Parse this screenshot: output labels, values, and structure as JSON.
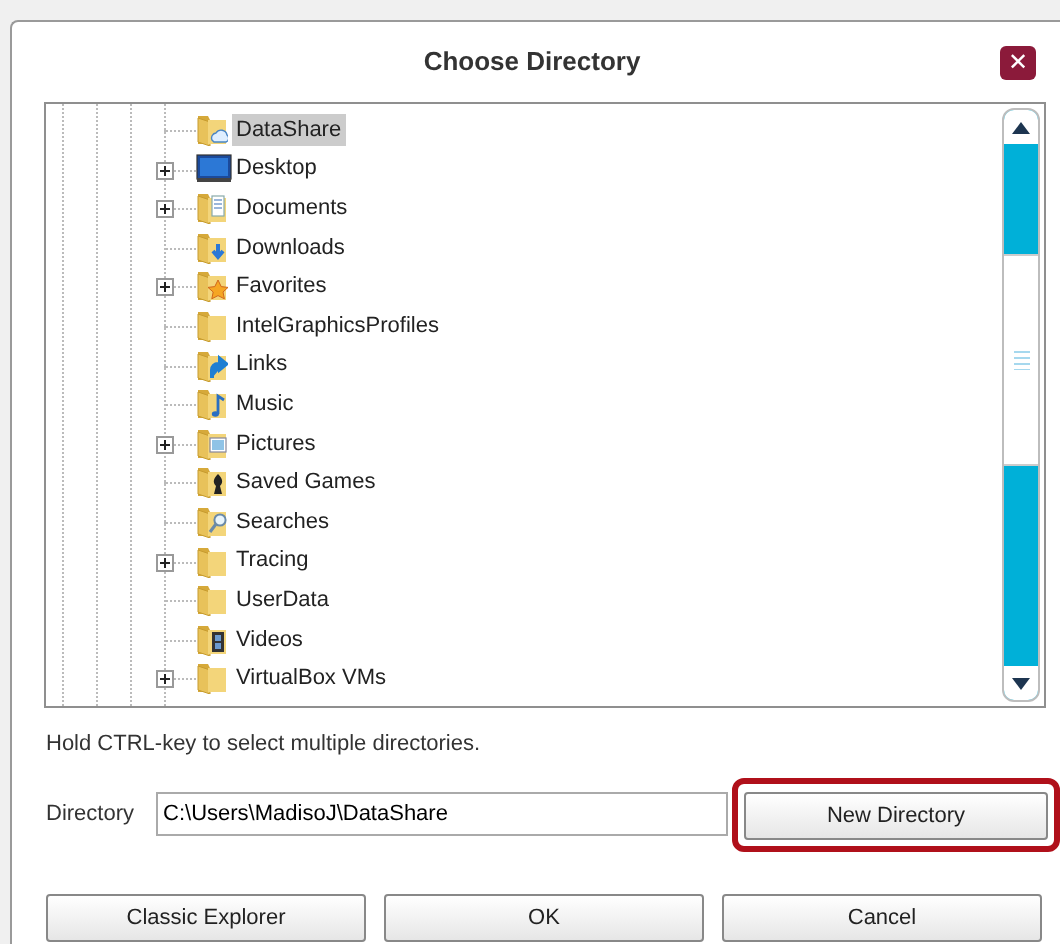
{
  "window": {
    "title": "Choose Directory",
    "close": "✕"
  },
  "tree": {
    "items": [
      {
        "label": "DataShare",
        "kind": "cloud",
        "expandable": false,
        "selected": true
      },
      {
        "label": "Desktop",
        "kind": "desktop",
        "expandable": true,
        "selected": false
      },
      {
        "label": "Documents",
        "kind": "documents",
        "expandable": true,
        "selected": false
      },
      {
        "label": "Downloads",
        "kind": "downloads",
        "expandable": false,
        "selected": false
      },
      {
        "label": "Favorites",
        "kind": "favorites",
        "expandable": true,
        "selected": false
      },
      {
        "label": "IntelGraphicsProfiles",
        "kind": "plain",
        "expandable": false,
        "selected": false
      },
      {
        "label": "Links",
        "kind": "links",
        "expandable": false,
        "selected": false
      },
      {
        "label": "Music",
        "kind": "music",
        "expandable": false,
        "selected": false
      },
      {
        "label": "Pictures",
        "kind": "pictures",
        "expandable": true,
        "selected": false
      },
      {
        "label": "Saved Games",
        "kind": "games",
        "expandable": false,
        "selected": false
      },
      {
        "label": "Searches",
        "kind": "searches",
        "expandable": false,
        "selected": false
      },
      {
        "label": "Tracing",
        "kind": "plain",
        "expandable": true,
        "selected": false
      },
      {
        "label": "UserData",
        "kind": "plain",
        "expandable": false,
        "selected": false
      },
      {
        "label": "Videos",
        "kind": "videos",
        "expandable": false,
        "selected": false
      },
      {
        "label": "VirtualBox VMs",
        "kind": "plain",
        "expandable": true,
        "selected": false
      }
    ]
  },
  "hint": "Hold CTRL-key to select multiple directories.",
  "directory": {
    "label": "Directory",
    "value": "C:\\Users\\MadisoJ\\DataShare"
  },
  "new_directory_button": {
    "label": "New Directory",
    "highlighted": true
  },
  "buttons": [
    {
      "label": "Classic Explorer"
    },
    {
      "label": "OK"
    },
    {
      "label": "Cancel"
    }
  ]
}
